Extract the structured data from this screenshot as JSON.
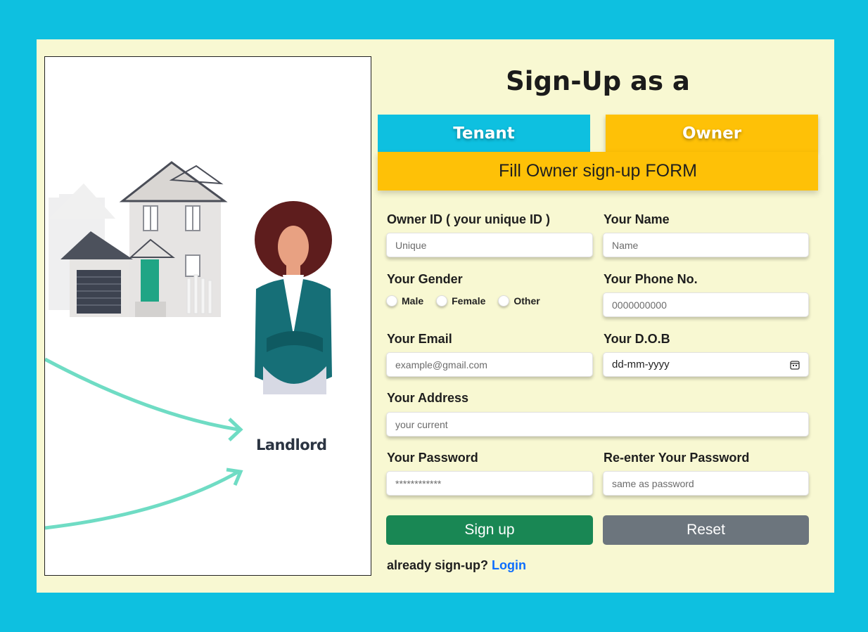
{
  "illustration": {
    "label": "Landlord"
  },
  "form": {
    "title": "Sign-Up as a",
    "tabs": {
      "tenant": "Tenant",
      "owner": "Owner"
    },
    "banner": "Fill Owner sign-up FORM",
    "fields": {
      "owner_id": {
        "label": "Owner ID ( your unique ID )",
        "placeholder": "Unique"
      },
      "name": {
        "label": "Your Name",
        "placeholder": "Name"
      },
      "gender": {
        "label": "Your Gender",
        "options": [
          "Male",
          "Female",
          "Other"
        ]
      },
      "phone": {
        "label": "Your Phone No.",
        "placeholder": "0000000000"
      },
      "email": {
        "label": "Your Email",
        "placeholder": "example@gmail.com"
      },
      "dob": {
        "label": "Your D.O.B",
        "value": "dd-mm-yyyy"
      },
      "address": {
        "label": "Your Address",
        "placeholder": "your current"
      },
      "password": {
        "label": "Your Password",
        "placeholder": "************"
      },
      "password_confirm": {
        "label": "Re-enter Your Password",
        "placeholder": "same as password"
      }
    },
    "buttons": {
      "signup": "Sign up",
      "reset": "Reset"
    },
    "login_prompt": "already sign-up?",
    "login_link": "Login"
  },
  "colors": {
    "background": "#0ec0e0",
    "card": "#f8f8d2",
    "tab_tenant": "#0ec0e0",
    "tab_owner": "#fec107",
    "signup_button": "#198754",
    "reset_button": "#6c757d",
    "link": "#0d6efd"
  }
}
